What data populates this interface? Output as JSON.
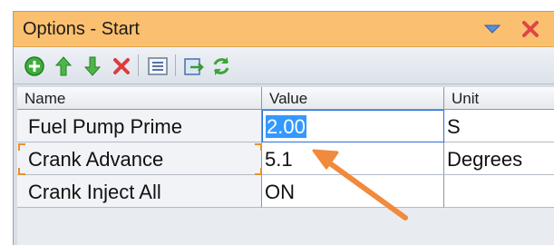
{
  "window": {
    "title": "Options - Start",
    "dropdown_icon": "triangle-down-icon",
    "close_icon": "close-x-icon",
    "accent_color": "#fbc06f"
  },
  "toolbar": {
    "tools": [
      {
        "icon": "add-circle-icon"
      },
      {
        "icon": "move-up-icon"
      },
      {
        "icon": "move-down-icon"
      },
      {
        "icon": "delete-icon"
      },
      {
        "icon": "list-view-icon"
      },
      {
        "icon": "export-icon"
      },
      {
        "icon": "refresh-icon"
      }
    ]
  },
  "grid": {
    "columns": {
      "name": "Name",
      "value": "Value",
      "unit": "Unit"
    },
    "rows": [
      {
        "name": "Fuel Pump Prime",
        "value": "2.00",
        "unit": "S",
        "editing": true
      },
      {
        "name": "Crank Advance",
        "value": "5.1",
        "unit": "Degrees"
      },
      {
        "name": "Crank Inject All",
        "value": "ON",
        "unit": ""
      }
    ]
  },
  "annotation": {
    "arrow_color": "#f08a3c"
  }
}
